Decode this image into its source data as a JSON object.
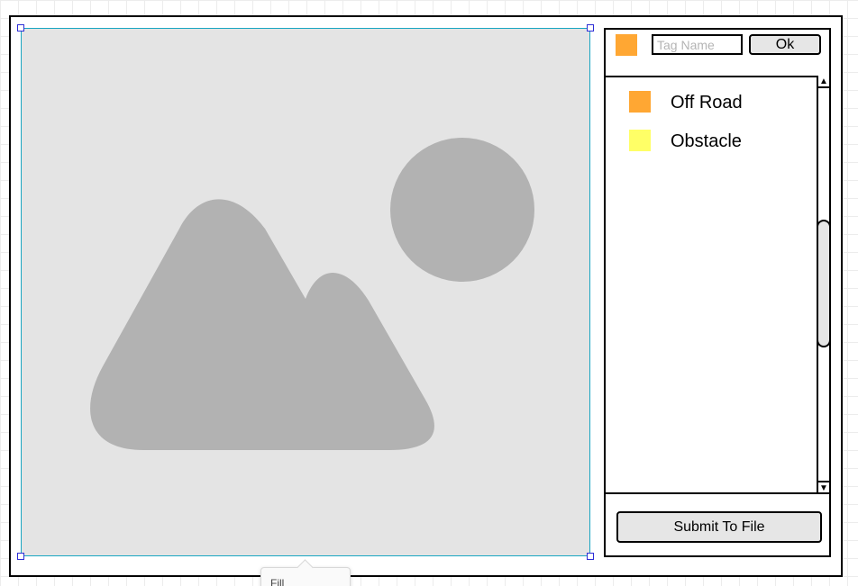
{
  "image_placeholder": {
    "icon": "image-placeholder-icon"
  },
  "tag_editor": {
    "current_color": "#ffa733",
    "tag_name_value": "",
    "tag_name_placeholder": "Tag Name",
    "ok_label": "Ok"
  },
  "tags": [
    {
      "label": "Off Road",
      "color": "#ffa733"
    },
    {
      "label": "Obstacle",
      "color": "#ffff66"
    }
  ],
  "scrollbar": {
    "up_icon": "arrow-up-icon",
    "down_icon": "arrow-down-icon"
  },
  "submit_label": "Submit To File",
  "tooltip": {
    "label": "Fill"
  }
}
